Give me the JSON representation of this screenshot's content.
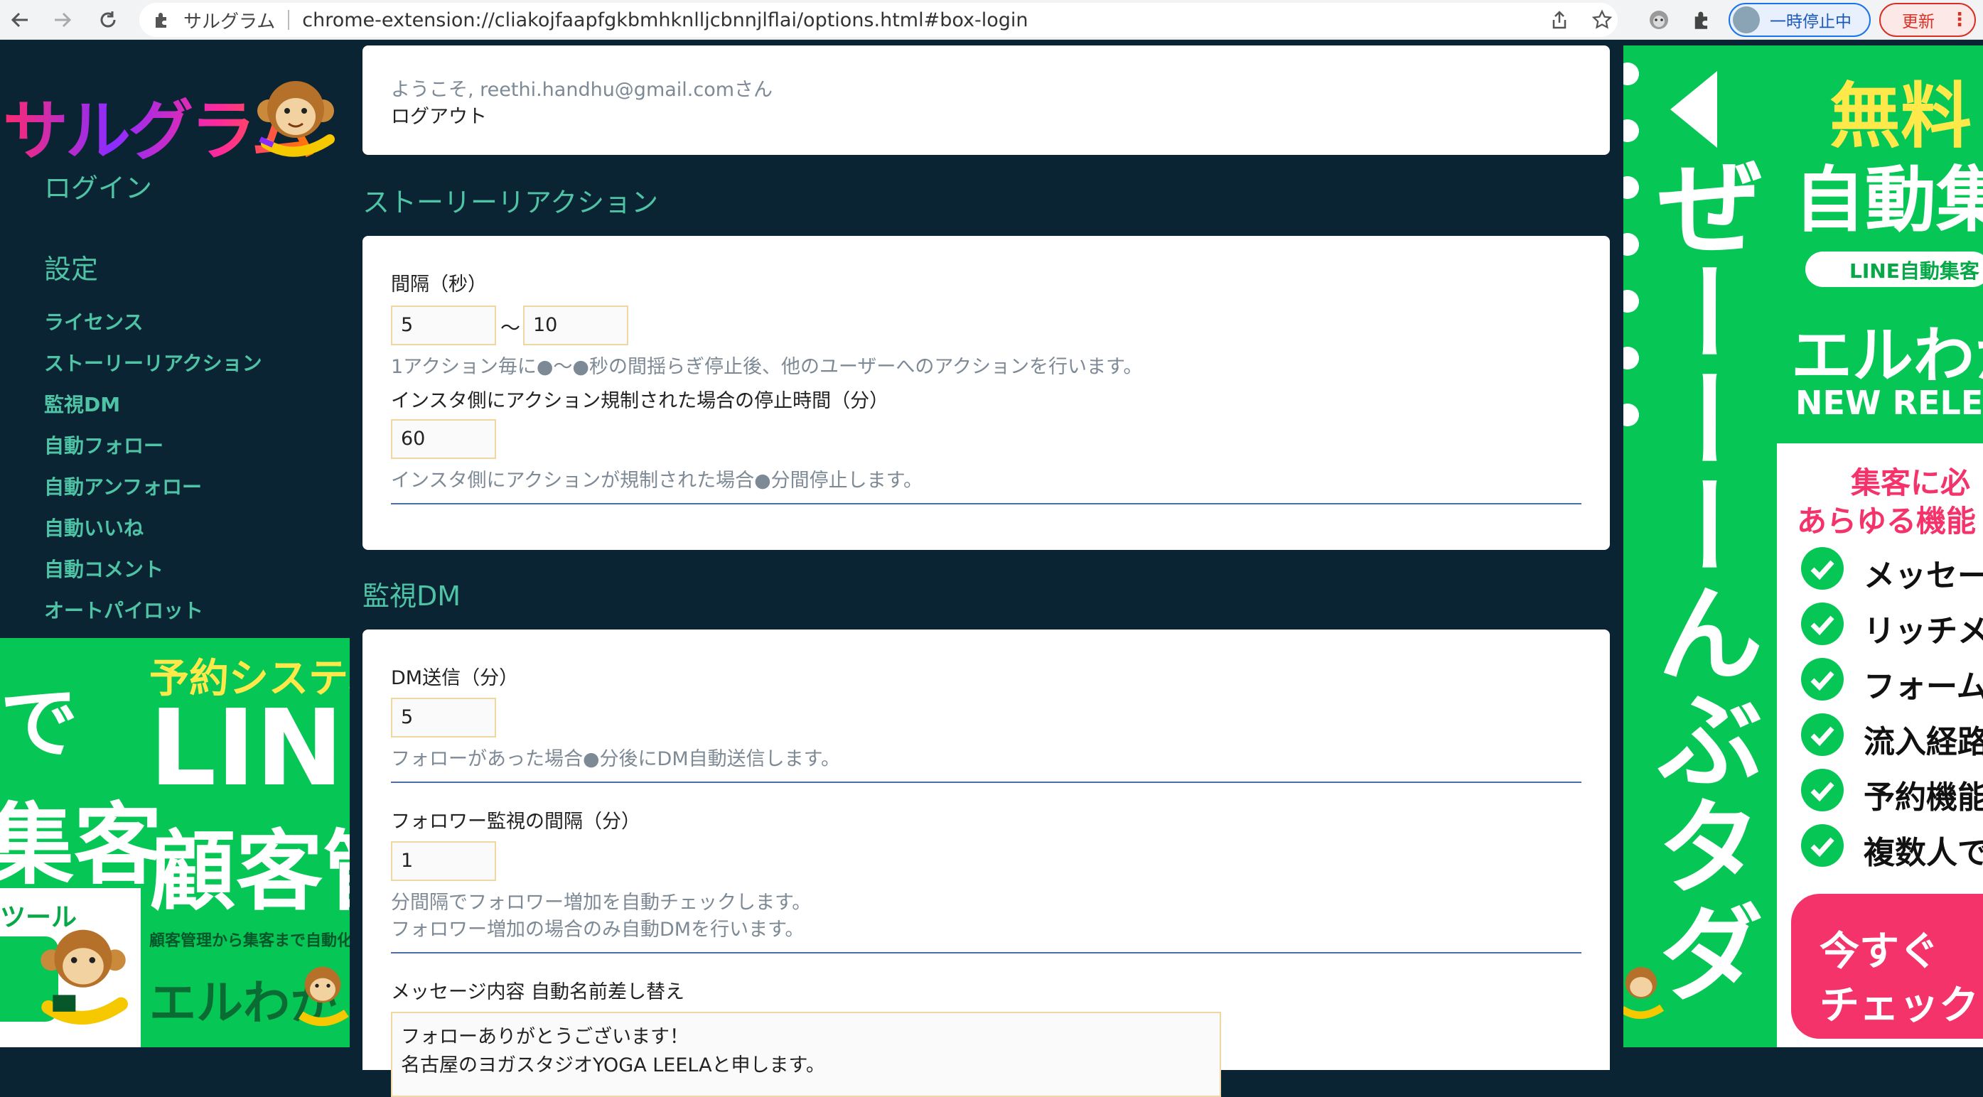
{
  "browser": {
    "app_name": "サルグラム",
    "url": "chrome-extension://cliakojfaapfgkbmhknlljcbnnjlflai/options.html#box-login",
    "profile_label": "一時停止中",
    "update_label": "更新"
  },
  "sidebar": {
    "logo_text": "サルグラム",
    "login": "ログイン",
    "settings": "設定",
    "items": [
      {
        "label": "ライセンス"
      },
      {
        "label": "ストーリーリアクション"
      },
      {
        "label": "監視DM"
      },
      {
        "label": "自動フォロー"
      },
      {
        "label": "自動アンフォロー"
      },
      {
        "label": "自動いいね"
      },
      {
        "label": "自動コメント"
      },
      {
        "label": "オートパイロット"
      }
    ]
  },
  "account": {
    "welcome": "ようこそ, reethi.handhu@gmail.comさん",
    "logout": "ログアウト"
  },
  "story": {
    "title": "ストーリーリアクション",
    "interval_label": "間隔（秒）",
    "interval_min": "5",
    "tilde": "〜",
    "interval_max": "10",
    "interval_hint": "1アクション毎に●〜●秒の間揺らぎ停止後、他のユーザーへのアクションを行います。",
    "stop_label": "インスタ側にアクション規制された場合の停止時間（分）",
    "stop_value": "60",
    "stop_hint": "インスタ側にアクションが規制された場合●分間停止します。"
  },
  "dm": {
    "title": "監視DM",
    "send_label": "DM送信（分）",
    "send_value": "5",
    "send_hint": "フォローがあった場合●分後にDM自動送信します。",
    "monitor_label": "フォロワー監視の間隔（分）",
    "monitor_value": "1",
    "monitor_hint1": "分間隔でフォロワー増加を自動チェックします。",
    "monitor_hint2": "フォロワー増加の場合のみ自動DMを行います。",
    "message_label": "メッセージ内容 自動名前差し替え",
    "message_line1": "フォローありがとうございます！",
    "message_line2": "名古屋のヨガスタジオYOGA LEELAと申します。"
  },
  "ad_left": {
    "line1": "予約システム",
    "line2": "LINE",
    "line3": "顧客管",
    "left1": "で",
    "left2": "集客",
    "left3": "ツール",
    "sub": "顧客管理から集客まで自動化",
    "brand": "エルわか"
  },
  "ad_right": {
    "free": "無料",
    "auto": "自動集",
    "pill": "LINE自動集客",
    "brand": "エルわか",
    "release": "NEW RELE",
    "vertical": "ぜーーーんぶタダ",
    "tag1": "集客に必",
    "tag2": "あらゆる機能",
    "checks": [
      "メッセー",
      "リッチメ",
      "フォーム",
      "流入経路",
      "予約機能",
      "複数人で"
    ],
    "cta1": "今すぐ",
    "cta2": "チェック"
  },
  "colors": {
    "background": "#0a2433",
    "accent": "#4ec3a5",
    "line_green": "#06c755",
    "cta_pink": "#f5336b"
  }
}
